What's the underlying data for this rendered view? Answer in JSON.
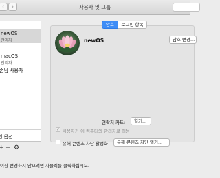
{
  "window": {
    "title": "사용자 및 그룹",
    "nav_back": "‹",
    "nav_forward": "›"
  },
  "sidebar": {
    "section_header": "",
    "users": [
      {
        "name": "newOS",
        "role": "관리자",
        "selected": true
      },
      {
        "name": "macOS",
        "role": "관리자",
        "selected": false
      }
    ],
    "guest_label": "손님 사용자",
    "login_options_label": "인 옵션"
  },
  "tabs": [
    {
      "label": "암호",
      "active": true
    },
    {
      "label": "로그인 항목",
      "active": false
    }
  ],
  "account": {
    "user_name": "newOS",
    "avatar_icon": "lotus-flower-avatar",
    "change_password_label": "암호 변경..."
  },
  "contact_card": {
    "label": "연락처 카드:",
    "open_button": "열기..."
  },
  "options": {
    "admin_checkbox": {
      "label": "사용자가 이 컴퓨터의 관리자로 허용",
      "checked": true,
      "enabled": false
    },
    "parental_checkbox": {
      "label": "유해 콘텐츠 차단 활성화",
      "checked": false,
      "enabled": true
    },
    "parental_button": "유해 콘텐츠 차단 열기..."
  },
  "toolbar": {
    "add_label": "+",
    "remove_label": "−",
    "gear_label": "⚙"
  },
  "bottom": {
    "lock_text": "이상 변경하지 않으려면 자물쇠를 클릭하십시오."
  }
}
